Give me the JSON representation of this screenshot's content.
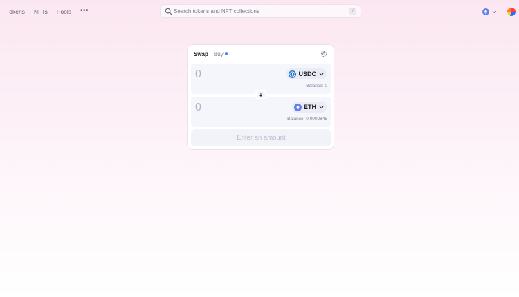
{
  "nav": {
    "links": [
      "Tokens",
      "NFTs",
      "Pools"
    ],
    "more_label": "•••"
  },
  "search": {
    "placeholder": "Search tokens and NFT collections",
    "shortcut": "/"
  },
  "header_right": {
    "chain_icon": "ethereum-icon",
    "avatar_icon": "wallet-avatar"
  },
  "swap_card": {
    "tabs": [
      {
        "label": "Swap",
        "active": true
      },
      {
        "label": "Buy",
        "active": false
      }
    ],
    "input_panel": {
      "amount_placeholder": "0",
      "token": "USDC",
      "token_icon": "usdc-icon",
      "balance": "Balance: 0"
    },
    "output_panel": {
      "amount_placeholder": "0",
      "token": "ETH",
      "token_icon": "eth-icon",
      "balance": "Balance: 0.0002845"
    },
    "action_button": "Enter an amount"
  },
  "colors": {
    "accent": "#4c82fb",
    "usdc": "#2775ca",
    "eth": "#627eea",
    "panel_bg": "#f5f6fc"
  }
}
